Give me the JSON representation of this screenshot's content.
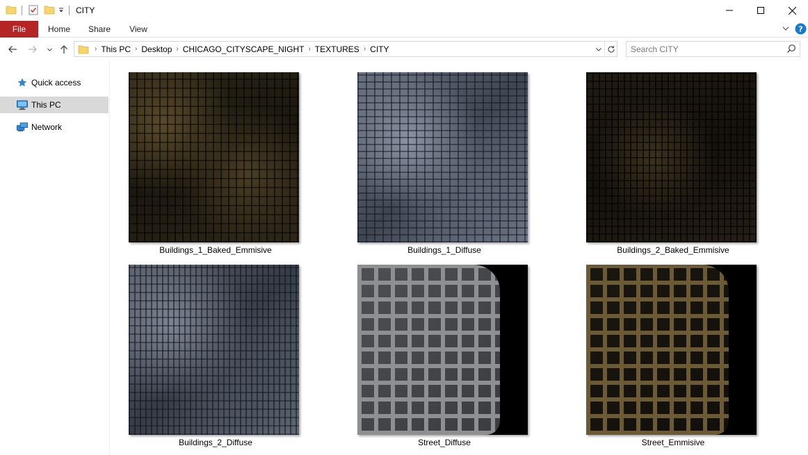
{
  "window": {
    "title": "CITY"
  },
  "ribbon": {
    "tabs": [
      "File",
      "Home",
      "Share",
      "View"
    ]
  },
  "address": {
    "breadcrumbs": [
      "This PC",
      "Desktop",
      "CHICAGO_CITYSCAPE_NIGHT",
      "TEXTURES",
      "CITY"
    ]
  },
  "search": {
    "placeholder": "Search CITY",
    "value": ""
  },
  "nav": {
    "items": [
      {
        "label": "Quick access",
        "icon": "star-icon",
        "selected": false
      },
      {
        "label": "This PC",
        "icon": "computer-icon",
        "selected": true
      },
      {
        "label": "Network",
        "icon": "network-icon",
        "selected": false
      }
    ]
  },
  "files": [
    {
      "name": "Buildings_1_Baked_Emmisive"
    },
    {
      "name": "Buildings_1_Diffuse"
    },
    {
      "name": "Buildings_2_Baked_Emmisive"
    },
    {
      "name": "Buildings_2_Diffuse"
    },
    {
      "name": "Street_Diffuse"
    },
    {
      "name": "Street_Emmisive"
    }
  ],
  "colors": {
    "file_tab": "#b52525",
    "selected_nav": "#d9d9d9",
    "folder": "#f6d56b",
    "accent": "#1979ca"
  }
}
